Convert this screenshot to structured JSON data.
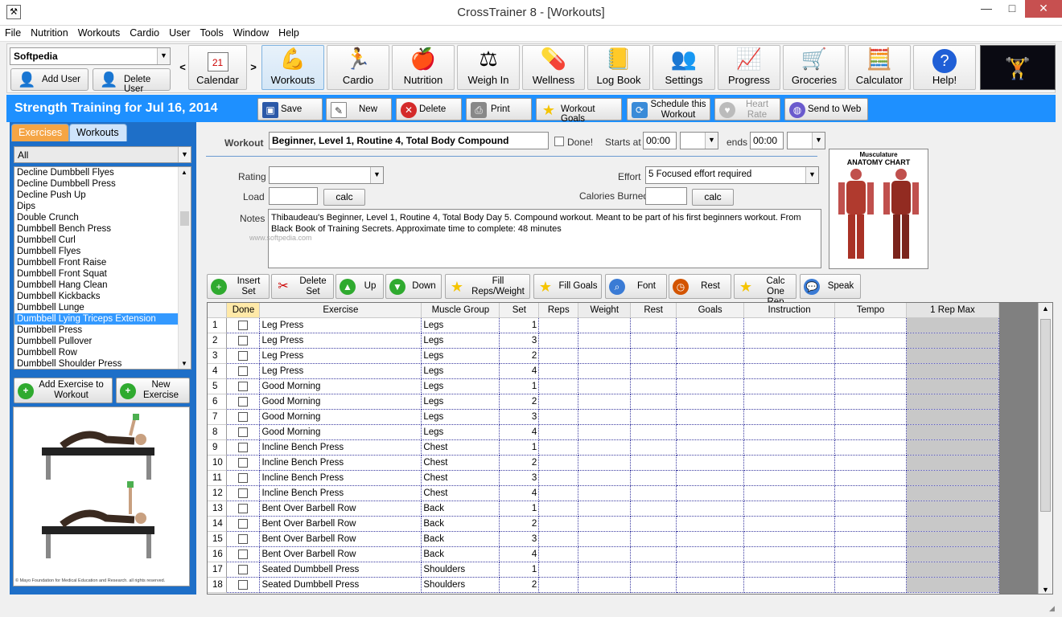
{
  "window": {
    "title": "CrossTrainer 8 - [Workouts]"
  },
  "menu": [
    "File",
    "Nutrition",
    "Workouts",
    "Cardio",
    "User",
    "Tools",
    "Window",
    "Help"
  ],
  "user": {
    "selected": "Softpedia",
    "add_label": "Add User",
    "delete_label": "Delete User"
  },
  "toolbar": [
    "Calendar",
    "Workouts",
    "Cardio",
    "Nutrition",
    "Weigh In",
    "Wellness",
    "Log Book",
    "Settings",
    "Progress",
    "Groceries",
    "Calculator",
    "Help!"
  ],
  "calendar_icon_day": "21",
  "header": {
    "title": "Strength Training for Jul 16, 2014"
  },
  "actions": {
    "save": "Save",
    "new": "New",
    "delete": "Delete",
    "print": "Print",
    "workout_goals": "Workout Goals",
    "schedule_1": "Schedule this",
    "schedule_2": "Workout",
    "heart_1": "Heart",
    "heart_2": "Rate",
    "send_web": "Send to Web"
  },
  "left": {
    "tab_exercises": "Exercises",
    "tab_workouts": "Workouts",
    "filter": "All",
    "exercises": [
      "Decline Dumbbell Flyes",
      "Decline Dumbbell Press",
      "Decline Push Up",
      "Dips",
      "Double Crunch",
      "Dumbbell Bench Press",
      "Dumbbell Curl",
      "Dumbbell Flyes",
      "Dumbbell Front Raise",
      "Dumbbell Front Squat",
      "Dumbbell Hang Clean",
      "Dumbbell Kickbacks",
      "Dumbbell Lunge",
      "Dumbbell Lying Triceps Extension",
      "Dumbbell Press",
      "Dumbbell Pullover",
      "Dumbbell Row",
      "Dumbbell Shoulder Press"
    ],
    "selected_index": 13,
    "add_ex_1": "Add Exercise to",
    "add_ex_2": "Workout",
    "new_ex_1": "New",
    "new_ex_2": "Exercise",
    "copyright": "© Mayo Foundation for Medical Education and Research. all rights reserved."
  },
  "form": {
    "workout_label": "Workout",
    "workout_value": "Beginner, Level 1, Routine 4, Total Body Compound",
    "done_label": "Done!",
    "starts_label": "Starts at",
    "starts_value": "00:00",
    "ends_label": "ends",
    "ends_value": "00:00",
    "rating_label": "Rating",
    "effort_label": "Effort",
    "effort_value": "5 Focused effort required",
    "load_label": "Load",
    "calories_label": "Calories Burned",
    "calc_label": "calc",
    "notes_label": "Notes",
    "notes_value": "Thibaudeau's Beginner, Level 1, Routine 4, Total Body  Day 5. Compound workout. Meant to be part of his first beginners workout. From Black Book of Training Secrets. Approximate time to complete: 48 minutes",
    "watermark": "www.softpedia.com",
    "chart_title_1": "Musculature",
    "chart_title_2": "ANATOMY CHART"
  },
  "grid_buttons": {
    "insert_1": "Insert",
    "insert_2": "Set",
    "delete_1": "Delete",
    "delete_2": "Set",
    "up": "Up",
    "down": "Down",
    "fill_1": "Fill",
    "fill_2": "Reps/Weight",
    "fill_goals": "Fill Goals",
    "font": "Font",
    "rest": "Rest",
    "calc1_1": "Calc One",
    "calc1_2": "Rep Max",
    "speak": "Speak"
  },
  "grid": {
    "columns": [
      "",
      "Done",
      "Exercise",
      "Muscle Group",
      "Set",
      "Reps",
      "Weight",
      "Rest",
      "Goals",
      "Instruction",
      "Tempo",
      "1 Rep Max"
    ],
    "rows": [
      [
        "1",
        "Leg Press",
        "Legs",
        "1"
      ],
      [
        "2",
        "Leg Press",
        "Legs",
        "3"
      ],
      [
        "3",
        "Leg Press",
        "Legs",
        "2"
      ],
      [
        "4",
        "Leg Press",
        "Legs",
        "4"
      ],
      [
        "5",
        "Good Morning",
        "Legs",
        "1"
      ],
      [
        "6",
        "Good Morning",
        "Legs",
        "2"
      ],
      [
        "7",
        "Good Morning",
        "Legs",
        "3"
      ],
      [
        "8",
        "Good Morning",
        "Legs",
        "4"
      ],
      [
        "9",
        "Incline Bench Press",
        "Chest",
        "1"
      ],
      [
        "10",
        "Incline Bench Press",
        "Chest",
        "2"
      ],
      [
        "11",
        "Incline Bench Press",
        "Chest",
        "3"
      ],
      [
        "12",
        "Incline Bench Press",
        "Chest",
        "4"
      ],
      [
        "13",
        "Bent Over Barbell Row",
        "Back",
        "1"
      ],
      [
        "14",
        "Bent Over Barbell Row",
        "Back",
        "2"
      ],
      [
        "15",
        "Bent Over Barbell Row",
        "Back",
        "3"
      ],
      [
        "16",
        "Bent Over Barbell Row",
        "Back",
        "4"
      ],
      [
        "17",
        "Seated Dumbbell Press",
        "Shoulders",
        "1"
      ],
      [
        "18",
        "Seated Dumbbell Press",
        "Shoulders",
        "2"
      ]
    ]
  },
  "colors": {
    "accent": "#1e90ff",
    "tab_active": "#f5a545",
    "selection": "#3399ff"
  }
}
